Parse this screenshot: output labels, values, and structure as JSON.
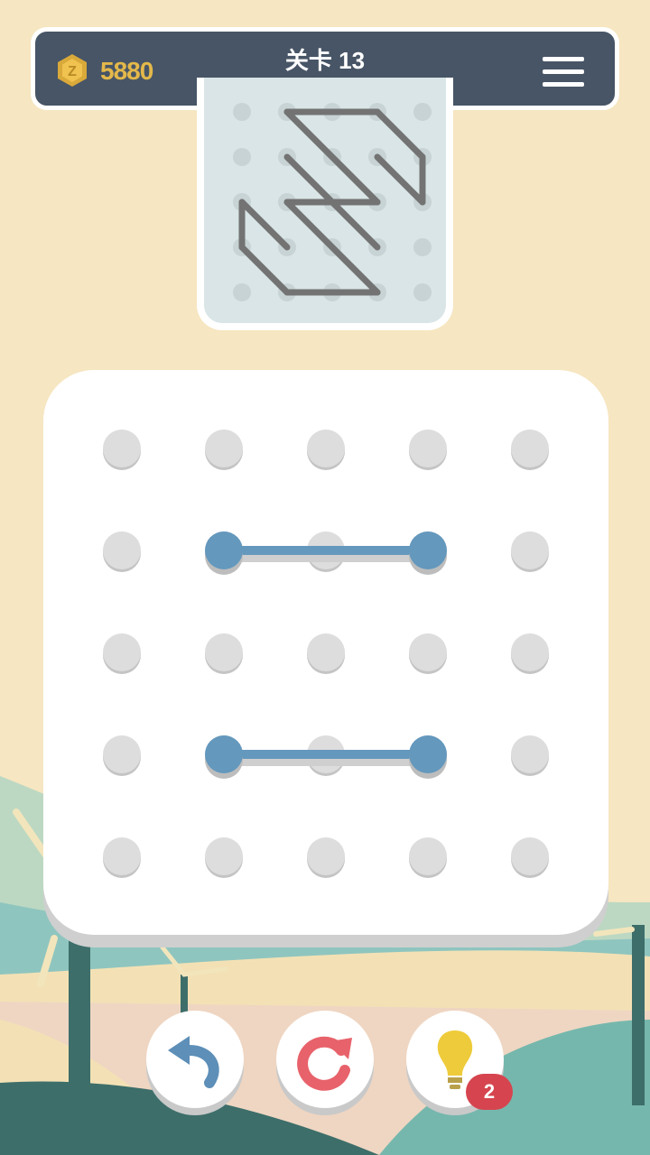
{
  "header": {
    "coins": "5880",
    "level_label": "关卡  13"
  },
  "colors": {
    "background": "#f6e6c1",
    "header_bg": "#475566",
    "coin_gold": "#e3b84a",
    "preview_bg": "#d9e5e6",
    "target_line": "#737373",
    "player_line": "#6498bd",
    "dot": "#dddddd",
    "undo_arrow": "#5d8fb8",
    "restart_arrow": "#e8626b",
    "hint_bulb": "#eecb3a",
    "badge_red": "#d6454f"
  },
  "icons": {
    "coin": "coin-icon",
    "menu": "hamburger-menu-icon",
    "undo": "undo-arrow-icon",
    "restart": "restart-icon",
    "hint": "lightbulb-icon"
  },
  "grid": {
    "rows": 5,
    "cols": 5
  },
  "target_pattern": [
    [
      [
        1,
        0
      ],
      [
        2,
        0
      ]
    ],
    [
      [
        2,
        0
      ],
      [
        3,
        0
      ]
    ],
    [
      [
        3,
        0
      ],
      [
        4,
        1
      ]
    ],
    [
      [
        4,
        1
      ],
      [
        4,
        2
      ]
    ],
    [
      [
        3,
        1
      ],
      [
        4,
        2
      ]
    ],
    [
      [
        1,
        0
      ],
      [
        3,
        2
      ]
    ],
    [
      [
        1,
        1
      ],
      [
        3,
        3
      ]
    ],
    [
      [
        2,
        2
      ],
      [
        3,
        2
      ]
    ],
    [
      [
        1,
        2
      ],
      [
        2,
        2
      ]
    ],
    [
      [
        1,
        2
      ],
      [
        3,
        4
      ]
    ],
    [
      [
        2,
        4
      ],
      [
        3,
        4
      ]
    ],
    [
      [
        1,
        4
      ],
      [
        2,
        4
      ]
    ],
    [
      [
        0,
        3
      ],
      [
        1,
        4
      ]
    ],
    [
      [
        0,
        2
      ],
      [
        0,
        3
      ]
    ],
    [
      [
        0,
        2
      ],
      [
        1,
        3
      ]
    ]
  ],
  "player_lines": [
    [
      [
        1,
        1
      ],
      [
        3,
        1
      ]
    ],
    [
      [
        1,
        3
      ],
      [
        3,
        3
      ]
    ]
  ],
  "controls": {
    "hint_count": "2"
  }
}
